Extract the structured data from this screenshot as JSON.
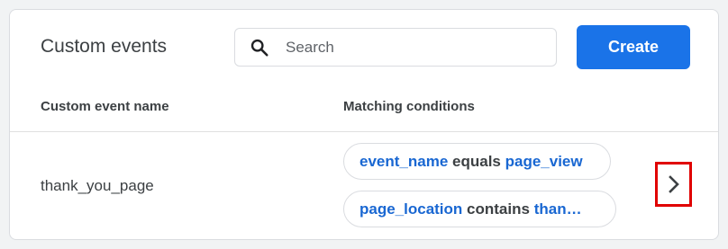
{
  "header": {
    "title": "Custom events",
    "search_placeholder": "Search",
    "create_label": "Create"
  },
  "table": {
    "columns": [
      "Custom event name",
      "Matching conditions"
    ],
    "rows": [
      {
        "name": "thank_you_page",
        "conditions": [
          {
            "parameter": "event_name",
            "operator": "equals",
            "value": "page_view"
          },
          {
            "parameter": "page_location",
            "operator": "contains",
            "value": "than…"
          }
        ]
      }
    ]
  },
  "icons": {
    "search": "search-icon",
    "row_action": "chevron-right-icon"
  },
  "colors": {
    "accent": "#1a73e8",
    "link_text": "#1967d2",
    "highlight_border": "#e00000"
  }
}
